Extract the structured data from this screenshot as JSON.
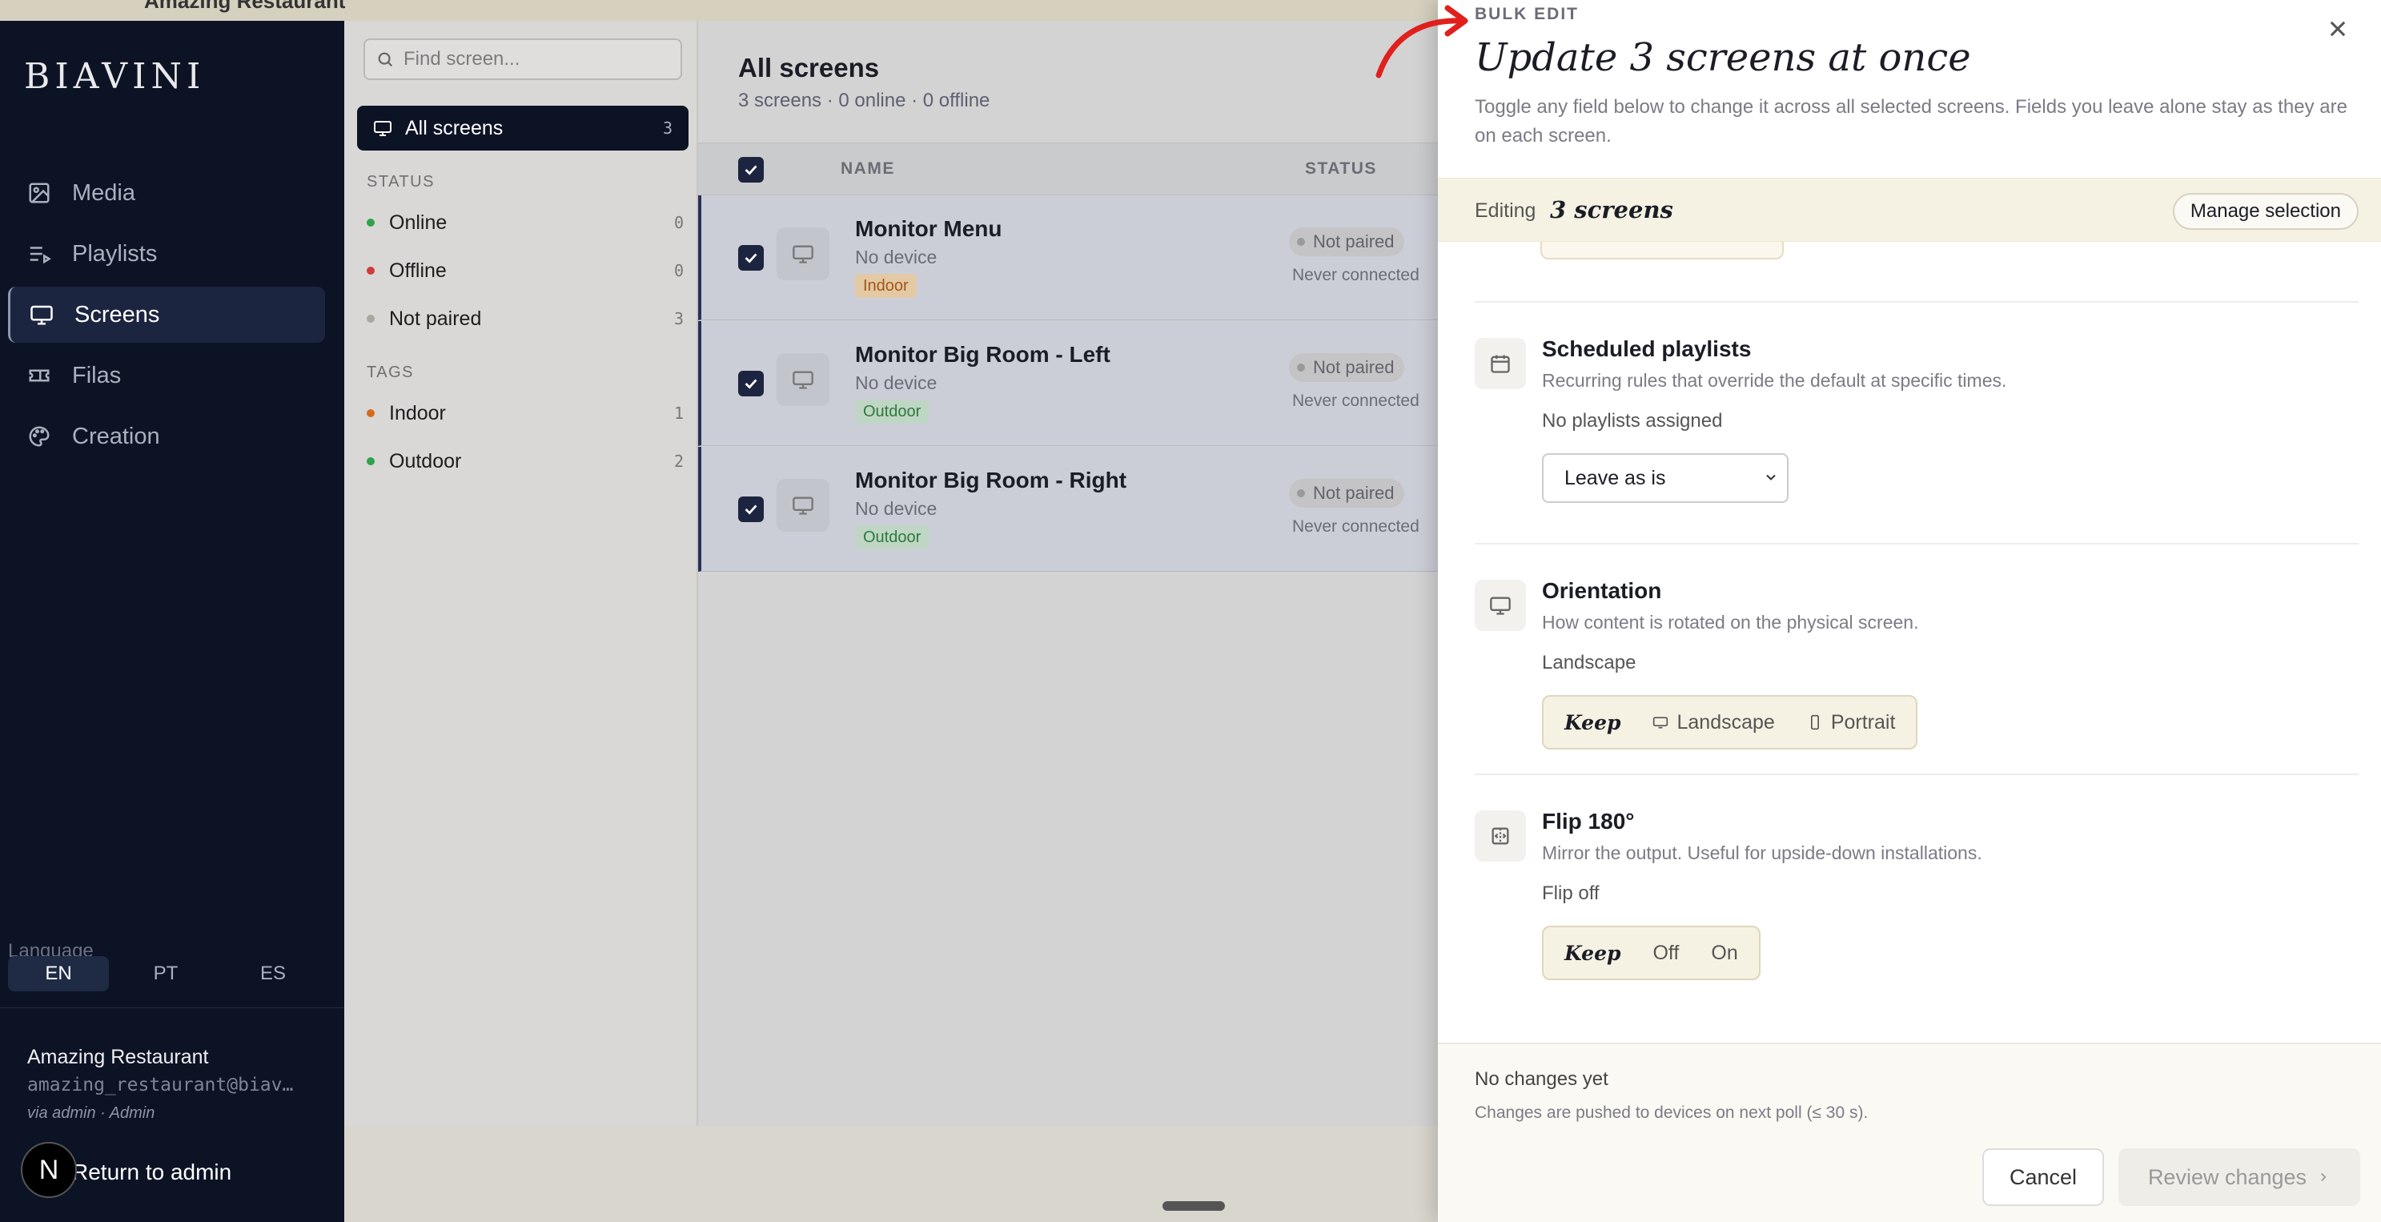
{
  "topstrip": {
    "text": "Amazing Restaurant"
  },
  "sidebar": {
    "logo": "BIAVINI",
    "nav": [
      {
        "label": "Media",
        "icon": "image-icon"
      },
      {
        "label": "Playlists",
        "icon": "playlist-icon"
      },
      {
        "label": "Screens",
        "icon": "monitor-icon",
        "active": true
      },
      {
        "label": "Filas",
        "icon": "ticket-icon"
      },
      {
        "label": "Creation",
        "icon": "palette-icon"
      }
    ],
    "language_label": "Language",
    "languages": [
      "EN",
      "PT",
      "ES"
    ],
    "active_language": "EN",
    "account": {
      "name": "Amazing Restaurant",
      "email": "amazing_restaurant@biav…",
      "via": "via admin · Admin"
    },
    "return_label": "Return to admin",
    "badge": "N"
  },
  "filters": {
    "search_placeholder": "Find screen...",
    "all": {
      "label": "All screens",
      "count": "3"
    },
    "status_label": "STATUS",
    "status": [
      {
        "label": "Online",
        "count": "0",
        "color": "#2fa24a"
      },
      {
        "label": "Offline",
        "count": "0",
        "color": "#d23b3b"
      },
      {
        "label": "Not paired",
        "count": "3",
        "color": "#a8a8a0"
      }
    ],
    "tags_label": "TAGS",
    "tags": [
      {
        "label": "Indoor",
        "count": "1",
        "color": "#d46b1c"
      },
      {
        "label": "Outdoor",
        "count": "2",
        "color": "#2fa24a"
      }
    ]
  },
  "main": {
    "title": "All screens",
    "subtitle": "3 screens · 0 online · 0 offline",
    "col_name": "NAME",
    "col_status": "STATUS",
    "rows": [
      {
        "name": "Monitor Menu",
        "device": "No device",
        "tag": "Indoor",
        "status": "Not paired",
        "last_seen": "Never connected"
      },
      {
        "name": "Monitor Big Room - Left",
        "device": "No device",
        "tag": "Outdoor",
        "status": "Not paired",
        "last_seen": "Never connected"
      },
      {
        "name": "Monitor Big Room - Right",
        "device": "No device",
        "tag": "Outdoor",
        "status": "Not paired",
        "last_seen": "Never connected"
      }
    ]
  },
  "drawer": {
    "eyebrow": "BULK EDIT",
    "title": "Update 3 screens at once",
    "description": "Toggle any field below to change it across all selected screens. Fields you leave alone stay as they are on each screen.",
    "editing_label": "Editing",
    "editing_value": "3 screens",
    "manage_label": "Manage selection",
    "scheduled": {
      "title": "Scheduled playlists",
      "desc": "Recurring rules that override the default at specific times.",
      "current": "No playlists assigned",
      "select_value": "Leave as is"
    },
    "orientation": {
      "title": "Orientation",
      "desc": "How content is rotated on the physical screen.",
      "current": "Landscape",
      "options": [
        "Keep",
        "Landscape",
        "Portrait"
      ]
    },
    "flip": {
      "title": "Flip 180°",
      "desc": "Mirror the output. Useful for upside-down installations.",
      "current": "Flip off",
      "options": [
        "Keep",
        "Off",
        "On"
      ]
    },
    "footer": {
      "status": "No changes yet",
      "note": "Changes are pushed to devices on next poll (≤ 30 s).",
      "cancel": "Cancel",
      "review": "Review changes"
    }
  },
  "colors": {
    "sidebar_bg": "#0c1325",
    "accent": "#1d2440",
    "annotation_arrow": "#e0201c"
  }
}
